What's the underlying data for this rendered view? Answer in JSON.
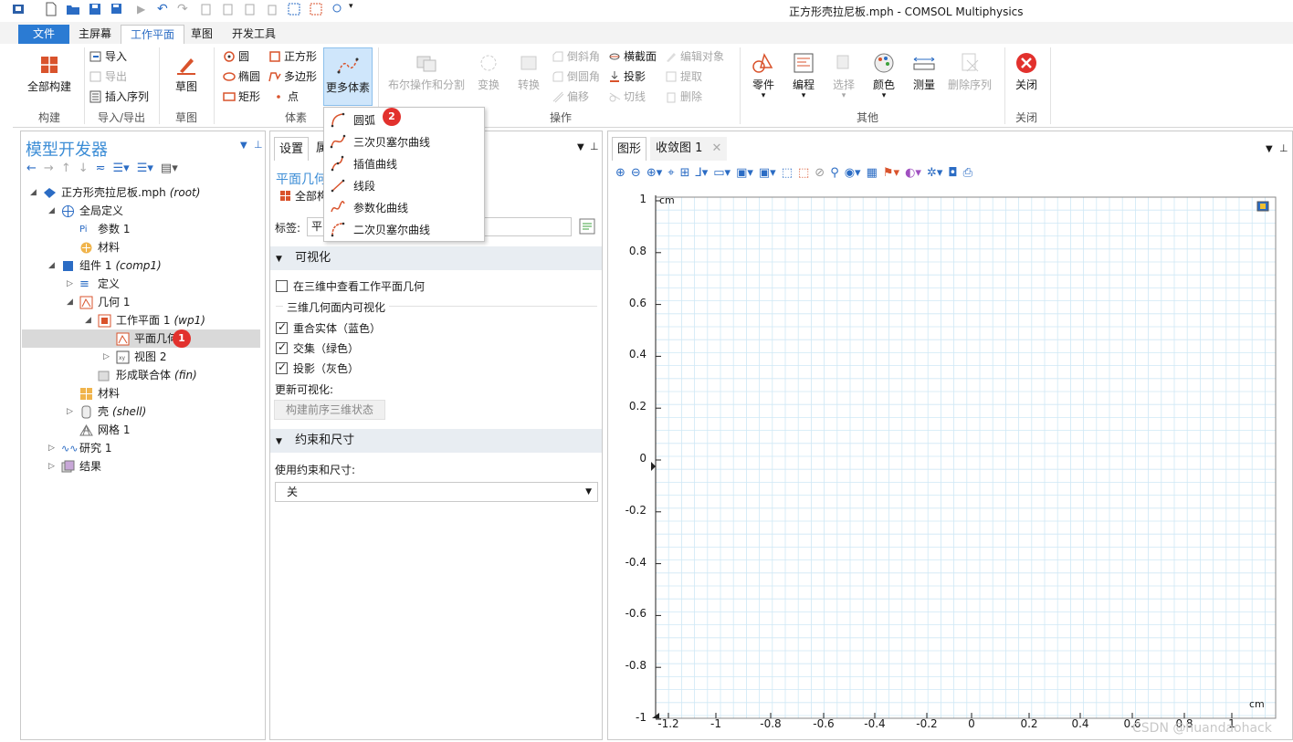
{
  "window": {
    "title": "正方形壳拉尼板.mph - COMSOL Multiphysics"
  },
  "tabs": [
    {
      "label": "文件"
    },
    {
      "label": "主屏幕"
    },
    {
      "label": "工作平面"
    },
    {
      "label": "草图"
    },
    {
      "label": "开发工具"
    }
  ],
  "ribbon": {
    "build": {
      "build_all": "全部构建",
      "group": "构建"
    },
    "import_export": {
      "import": "导入",
      "export": "导出",
      "insert_sequence": "插入序列",
      "group": "导入/导出"
    },
    "sketch": {
      "label": "草图",
      "group": "草图"
    },
    "primitives": {
      "circle": "圆",
      "ellipse": "椭圆",
      "rectangle": "矩形",
      "square": "正方形",
      "polygon": "多边形",
      "point": "点",
      "more": "更多体素",
      "group": "体素"
    },
    "operations": {
      "boolean": "布尔操作和分割",
      "transform": "变换",
      "convert": "转换",
      "chamfer": "倒斜角",
      "fillet": "倒圆角",
      "offset": "偏移",
      "cross_section": "横截面",
      "projection": "投影",
      "tangent": "切线",
      "edit_object": "编辑对象",
      "extract": "提取",
      "delete": "删除",
      "group": "操作"
    },
    "other": {
      "parts": "零件",
      "programming": "编程",
      "selection": "选择",
      "color": "颜色",
      "measure": "测量",
      "delete_sequence": "删除序列",
      "group": "其他"
    },
    "close": {
      "label": "关闭",
      "group": "关闭"
    }
  },
  "dropdown": {
    "items": [
      {
        "label": "圆弧"
      },
      {
        "label": "三次贝塞尔曲线"
      },
      {
        "label": "插值曲线"
      },
      {
        "label": "线段"
      },
      {
        "label": "参数化曲线"
      },
      {
        "label": "二次贝塞尔曲线"
      }
    ],
    "badge": "2"
  },
  "model_builder": {
    "title": "模型开发器",
    "tree": [
      {
        "label": "正方形壳拉尼板.mph",
        "tag": "(root)"
      },
      {
        "label": "全局定义",
        "tag": ""
      },
      {
        "label": "参数 1",
        "tag": ""
      },
      {
        "label": "材料",
        "tag": ""
      },
      {
        "label": "组件 1",
        "tag": "(comp1)"
      },
      {
        "label": "定义",
        "tag": ""
      },
      {
        "label": "几何 1",
        "tag": ""
      },
      {
        "label": "工作平面 1",
        "tag": "(wp1)"
      },
      {
        "label": "平面几何",
        "tag": ""
      },
      {
        "label": "视图 2",
        "tag": ""
      },
      {
        "label": "形成联合体",
        "tag": "(fin)"
      },
      {
        "label": "材料",
        "tag": ""
      },
      {
        "label": "壳",
        "tag": "(shell)"
      },
      {
        "label": "网格 1",
        "tag": ""
      },
      {
        "label": "研究 1",
        "tag": ""
      },
      {
        "label": "结果",
        "tag": ""
      }
    ],
    "badge": "1"
  },
  "settings": {
    "tabs": [
      {
        "label": "设置"
      },
      {
        "label": "属"
      }
    ],
    "heading": "平面几何",
    "build_all": "全部构",
    "label_caption": "标签:",
    "label_value": "平",
    "visualization": {
      "header": "可视化",
      "view_in_3d": "在三维中查看工作平面几何",
      "subsection": "三维几何面内可视化",
      "coincident": "重合实体（蓝色）",
      "intersection": "交集（绿色）",
      "projection": "投影（灰色）",
      "update_caption": "更新可视化:",
      "build_button": "构建前序三维状态"
    },
    "constraints": {
      "header": "约束和尺寸",
      "use_caption": "使用约束和尺寸:",
      "select_value": "关"
    }
  },
  "graphics": {
    "tabs": [
      {
        "label": "图形"
      },
      {
        "label": "收敛图 1"
      }
    ],
    "unit_top": "cm",
    "unit_bottom": "cm",
    "y_ticks": [
      "1",
      "0.8",
      "0.6",
      "0.4",
      "0.2",
      "0",
      "-0.2",
      "-0.4",
      "-0.6",
      "-0.8",
      "-1"
    ],
    "x_ticks": [
      "-1.2",
      "-1",
      "-0.8",
      "-0.6",
      "-0.4",
      "-0.2",
      "0",
      "0.2",
      "0.4",
      "0.6",
      "0.8",
      "1"
    ],
    "watermark": "CSDN @huandaohack"
  },
  "colors": {
    "accent": "#2b7bd3",
    "grid": "#cfe8f5",
    "badge": "#e2312d",
    "icon_red": "#d9532c"
  }
}
